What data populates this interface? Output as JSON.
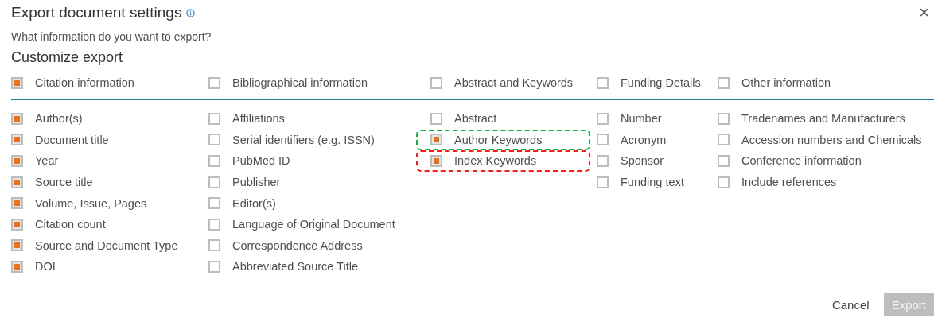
{
  "dialog": {
    "title": "Export document settings",
    "close": "×",
    "question": "What information do you want to export?",
    "section_title": "Customize export"
  },
  "groups": [
    {
      "label": "Citation information",
      "checked": true,
      "fields": [
        {
          "label": "Author(s)",
          "checked": true
        },
        {
          "label": "Document title",
          "checked": true
        },
        {
          "label": "Year",
          "checked": true
        },
        {
          "label": "Source title",
          "checked": true
        },
        {
          "label": "Volume, Issue, Pages",
          "checked": true
        },
        {
          "label": "Citation count",
          "checked": true
        },
        {
          "label": "Source and Document Type",
          "checked": true
        },
        {
          "label": "DOI",
          "checked": true
        }
      ]
    },
    {
      "label": "Bibliographical information",
      "checked": false,
      "fields": [
        {
          "label": "Affiliations",
          "checked": false
        },
        {
          "label": "Serial identifiers (e.g. ISSN)",
          "checked": false
        },
        {
          "label": "PubMed ID",
          "checked": false
        },
        {
          "label": "Publisher",
          "checked": false
        },
        {
          "label": "Editor(s)",
          "checked": false
        },
        {
          "label": "Language of Original Document",
          "checked": false
        },
        {
          "label": "Correspondence Address",
          "checked": false
        },
        {
          "label": "Abbreviated Source Title",
          "checked": false
        }
      ]
    },
    {
      "label": "Abstract and Keywords",
      "checked": false,
      "fields": [
        {
          "label": "Abstract",
          "checked": false
        },
        {
          "label": "Author Keywords",
          "checked": true,
          "color": "#1aab4b"
        },
        {
          "label": "Index Keywords",
          "checked": true,
          "color": "#ee1c1c"
        }
      ]
    },
    {
      "label": "Funding Details",
      "checked": false,
      "fields": [
        {
          "label": "Number",
          "checked": false
        },
        {
          "label": "Acronym",
          "checked": false
        },
        {
          "label": "Sponsor",
          "checked": false
        },
        {
          "label": "Funding text",
          "checked": false
        }
      ]
    },
    {
      "label": "Other information",
      "checked": false,
      "fields": [
        {
          "label": "Tradenames and Manufacturers",
          "checked": false
        },
        {
          "label": "Accession numbers and Chemicals",
          "checked": false
        },
        {
          "label": "Conference information",
          "checked": false
        },
        {
          "label": "Include references",
          "checked": false
        }
      ]
    }
  ],
  "buttons": [
    {
      "label": "Cancel",
      "kind": "link",
      "disabled": false
    },
    {
      "label": "Export",
      "kind": "primary",
      "disabled": true
    }
  ]
}
